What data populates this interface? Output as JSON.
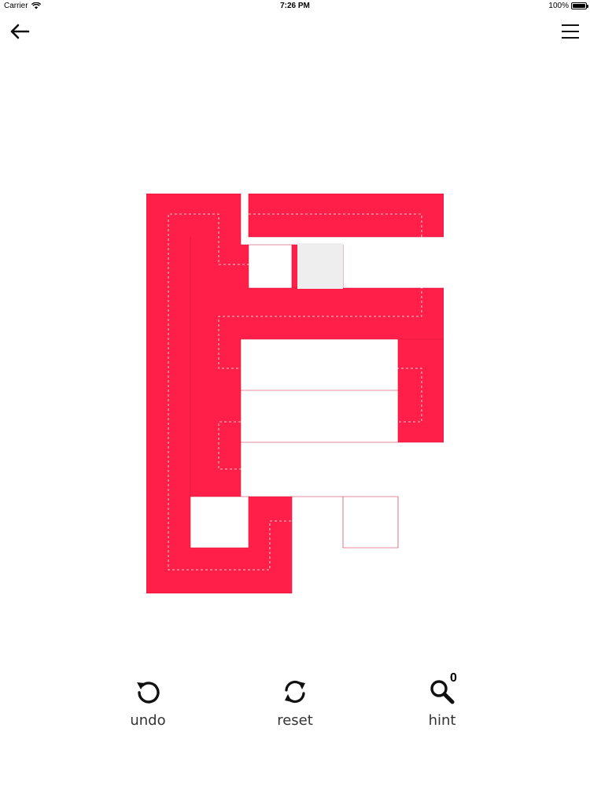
{
  "status_bar": {
    "carrier": "Carrier",
    "time": "7:26 PM",
    "battery": "100%",
    "battery_level_percent": 100
  },
  "header": {
    "back_icon": "arrow-left-icon",
    "menu_icon": "hamburger-menu-icon"
  },
  "maze": {
    "wall_color": "#ff1f48",
    "wall_shadow_color": "#cc1638",
    "path_hint_color": "#ffffff",
    "highlight_cell_color": "#eeeeee",
    "background_color": "#ffffff"
  },
  "toolbar": {
    "undo": {
      "label": "undo",
      "icon": "undo-icon"
    },
    "reset": {
      "label": "reset",
      "icon": "reset-icon"
    },
    "hint": {
      "label": "hint",
      "icon": "magnifier-icon",
      "count": "0"
    }
  }
}
